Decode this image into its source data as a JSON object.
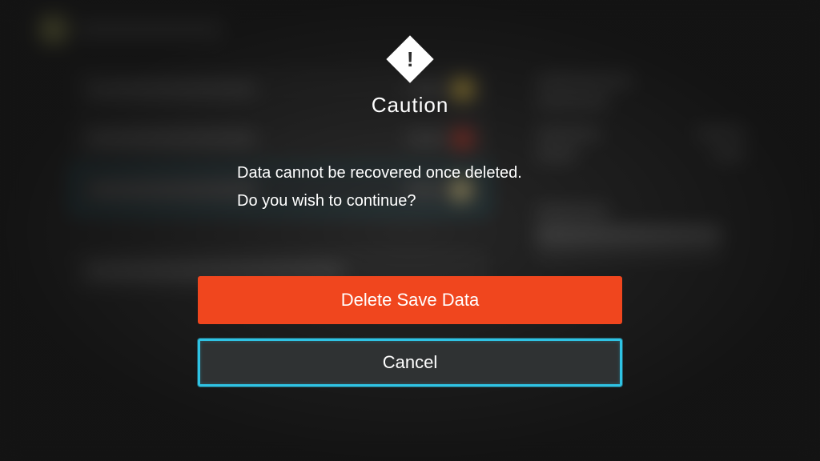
{
  "dialog": {
    "title": "Caution",
    "message_line1": "Data cannot be recovered once deleted.",
    "message_line2": "Do you wish to continue?",
    "primary_button": "Delete Save Data",
    "secondary_button": "Cancel",
    "icon_glyph": "!"
  },
  "colors": {
    "primary_button": "#f0461e",
    "focus_ring": "#2fc3e4",
    "background": "#2b2b2b"
  }
}
